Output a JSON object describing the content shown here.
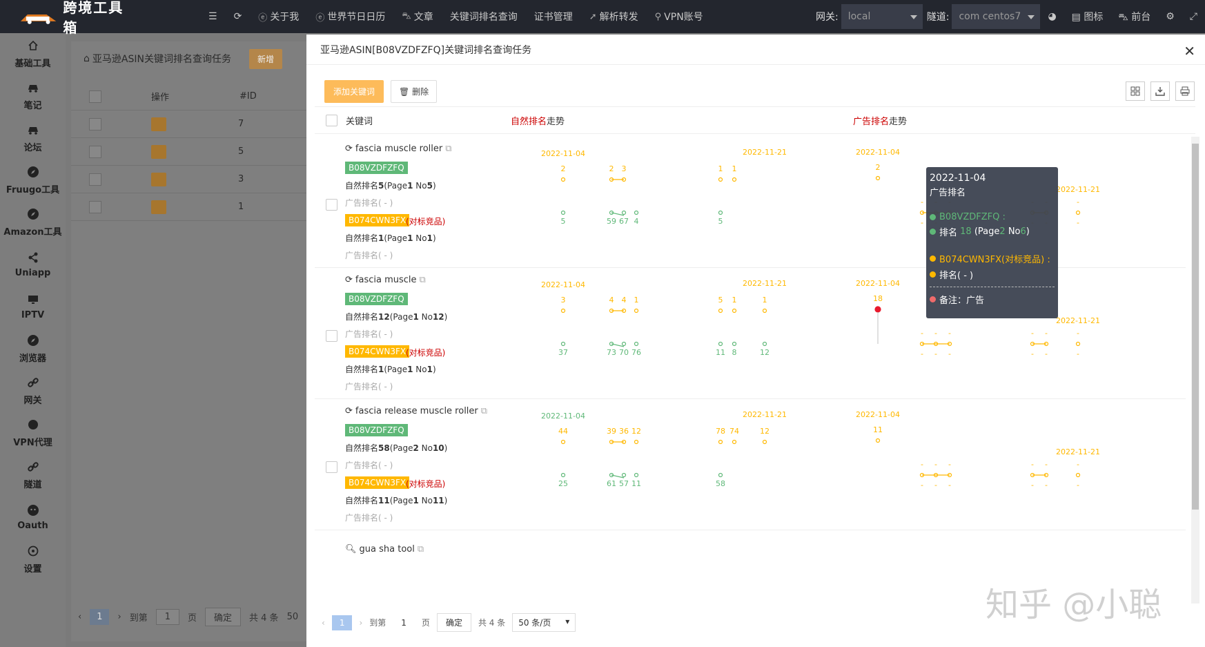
{
  "app": {
    "title": "跨境工具箱"
  },
  "topnav": {
    "items": [
      "关于我",
      "世界节日日历",
      "文章",
      "关键词排名查询",
      "证书管理",
      "解析转发",
      "VPN账号"
    ],
    "gateway_label": "网关:",
    "gateway_value": "local",
    "tunnel_label": "隧道:",
    "tunnel_value": "com centos7",
    "right_items": [
      "图标",
      "前台"
    ]
  },
  "sidebar": {
    "items": [
      {
        "label": "基础工具",
        "icon": "home-icon"
      },
      {
        "label": "笔记",
        "icon": "car-icon"
      },
      {
        "label": "论坛",
        "icon": "car-icon"
      },
      {
        "label": "Fruugo工具",
        "icon": "compass-icon"
      },
      {
        "label": "Amazon工具",
        "icon": "compass-icon"
      },
      {
        "label": "Uniapp",
        "icon": "share-icon"
      },
      {
        "label": "IPTV",
        "icon": "monitor-icon"
      },
      {
        "label": "浏览器",
        "icon": "compass-icon"
      },
      {
        "label": "网关",
        "icon": "link-icon"
      },
      {
        "label": "VPN代理",
        "icon": "circle-icon"
      },
      {
        "label": "隧道",
        "icon": "link-icon"
      },
      {
        "label": "Oauth",
        "icon": "wechat-icon"
      },
      {
        "label": "设置",
        "icon": "settings-icon"
      }
    ]
  },
  "bgpage": {
    "breadcrumb": "亚马逊ASIN关键词排名查询任务",
    "new_label": "新增",
    "col_op": "操作",
    "col_id": "#ID",
    "rows": [
      "7",
      "5",
      "3",
      "1"
    ],
    "pager": {
      "goto": "到第",
      "page_val": "1",
      "page_unit": "页",
      "confirm": "确定",
      "total": "共 4 条",
      "size": "50",
      "current": "1"
    }
  },
  "modal": {
    "title": "亚马逊ASIN[B08VZDFZFQ]关键词排名查询任务",
    "add_keyword": "添加关键词",
    "delete": "删除",
    "col_keyword": "关键词",
    "col_natural": "自然排名",
    "col_natural_suffix": "走势",
    "col_ad": "广告排名",
    "col_ad_suffix": "走势",
    "rows": [
      {
        "keyword": "fascia muscle roller",
        "icon": "refresh-icon",
        "asin1": "B08VZDFZFQ",
        "natural1_prefix": "自然排名",
        "natural1_rank": "5",
        "natural1_page": "1",
        "natural1_no": "5",
        "ad1": "广告排名( - )",
        "asin2": "B074CWN3FX",
        "asin2_note": "(对标竞品)",
        "natural2_rank": "1",
        "natural2_page": "1",
        "natural2_no": "1",
        "ad2": "广告排名( - )"
      },
      {
        "keyword": "fascia muscle",
        "icon": "refresh-icon",
        "asin1": "B08VZDFZFQ",
        "natural1_prefix": "自然排名",
        "natural1_rank": "12",
        "natural1_page": "1",
        "natural1_no": "12",
        "ad1": "广告排名( - )",
        "asin2": "B074CWN3FX",
        "asin2_note": "(对标竞品)",
        "natural2_rank": "1",
        "natural2_page": "1",
        "natural2_no": "1",
        "ad2": "广告排名( - )"
      },
      {
        "keyword": "fascia release muscle roller",
        "icon": "refresh-icon",
        "asin1": "B08VZDFZFQ",
        "natural1_prefix": "自然排名",
        "natural1_rank": "58",
        "natural1_page": "2",
        "natural1_no": "10",
        "ad1": "广告排名( - )",
        "asin2": "B074CWN3FX",
        "asin2_note": "(对标竞品)",
        "natural2_rank": "11",
        "natural2_page": "1",
        "natural2_no": "11",
        "ad2": "广告排名( - )"
      },
      {
        "keyword": "gua sha tool",
        "icon": "search-icon"
      }
    ],
    "tooltip": {
      "date": "2022-11-04",
      "title": "广告排名",
      "asin1": "B08VZDFZFQ :",
      "asin1_rank_prefix": "排名",
      "asin1_rank": "18",
      "asin1_page_prefix": "(Page",
      "asin1_page": "2",
      "asin1_no_prefix": "No",
      "asin1_no": "6",
      "asin1_close": ")",
      "asin2": "B074CWN3FX(对标竞品) :",
      "asin2_rank": "排名( - )",
      "note": "备注：广告"
    },
    "pager": {
      "current": "1",
      "goto": "到第",
      "page_val": "1",
      "page_unit": "页",
      "confirm": "确定",
      "total": "共 4 条",
      "size": "50 条/页"
    }
  },
  "colors": {
    "green": "#5fb878",
    "yellow": "#ffb800",
    "red": "#e8192c",
    "warn": "#fdbb5a",
    "topbar": "#23262e"
  },
  "watermark": "知乎 @小聪",
  "chart_data": [
    {
      "type": "line",
      "keyword": "fascia muscle roller",
      "natural": {
        "dates": [
          "2022-11-04",
          "2022-11-21"
        ],
        "green_labels": [
          "5",
          "59",
          "67",
          "4",
          "5"
        ],
        "yellow_labels": [
          "2",
          "2",
          "3",
          "1",
          "1"
        ]
      },
      "ad": {
        "dates": [
          "2022-11-04",
          "2022-11-21"
        ],
        "labels": [
          "2"
        ]
      }
    },
    {
      "type": "line",
      "keyword": "fascia muscle",
      "natural": {
        "dates": [
          "2022-11-04",
          "2022-11-21"
        ],
        "green_labels": [
          "37",
          "73",
          "70",
          "76",
          "11",
          "8",
          "12"
        ],
        "yellow_labels": [
          "3",
          "4",
          "4",
          "5",
          "1",
          "1",
          "1"
        ]
      },
      "ad": {
        "dates": [
          "2022-11-04",
          "2022-11-21"
        ],
        "labels": [
          "18"
        ]
      }
    },
    {
      "type": "line",
      "keyword": "fascia release muscle roller",
      "natural": {
        "dates": [
          "2022-11-04",
          "2022-11-21"
        ],
        "green_labels": [
          "25",
          "61",
          "57",
          "11",
          "58"
        ],
        "yellow_labels": [
          "44",
          "39",
          "36",
          "78",
          "74",
          "12",
          "12"
        ]
      },
      "ad": {
        "dates": [
          "2022-11-04",
          "2022-11-21"
        ],
        "labels": [
          "11"
        ]
      }
    }
  ]
}
